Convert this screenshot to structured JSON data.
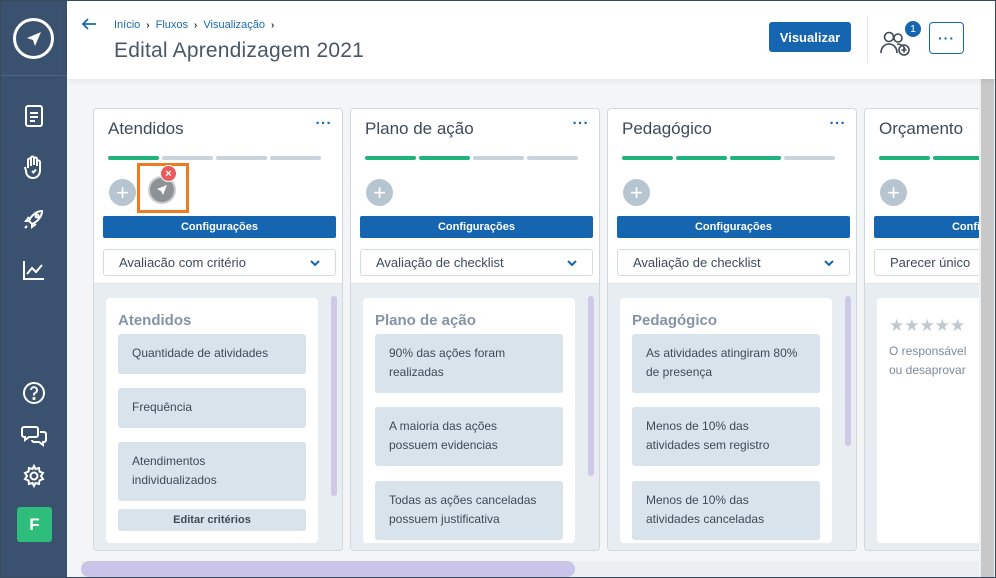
{
  "sidebar": {
    "logo_icon": "paper-plane-logo",
    "items": [
      {
        "icon": "document-icon"
      },
      {
        "icon": "hand-heart-icon"
      },
      {
        "icon": "rocket-icon"
      },
      {
        "icon": "chart-icon"
      }
    ],
    "bottom": [
      {
        "icon": "help-icon"
      },
      {
        "icon": "chat-icon"
      },
      {
        "icon": "gear-icon"
      }
    ],
    "avatar_letter": "F"
  },
  "header": {
    "breadcrumb": [
      "Início",
      "Fluxos",
      "Visualização"
    ],
    "title": "Edital Aprendizagem 2021",
    "visualizar_label": "Visualizar",
    "users_badge": "1",
    "more_label": "···"
  },
  "columns": [
    {
      "title": "Atendidos",
      "menu": "···",
      "progress_done": 1,
      "progress_total": 4,
      "config_label": "Configurações",
      "select_value": "Avaliacão com critério",
      "card_title": "Atendidos",
      "criteria": [
        "Quantidade de atividades",
        "Frequência",
        "Atendimentos individualizados"
      ],
      "edit_label": "Editar critérios"
    },
    {
      "title": "Plano de ação",
      "menu": "···",
      "progress_done": 2,
      "progress_total": 4,
      "config_label": "Configurações",
      "select_value": "Avaliação de checklist",
      "card_title": "Plano de ação",
      "criteria": [
        "90% das ações foram realizadas",
        "A maioria das ações possuem evidencias",
        "Todas as ações canceladas possuem justificativa"
      ]
    },
    {
      "title": "Pedagógico",
      "menu": "···",
      "progress_done": 3,
      "progress_total": 4,
      "config_label": "Configurações",
      "select_value": "Avaliação de checklist",
      "card_title": "Pedagógico",
      "criteria": [
        "As atividades atingiram 80% de presença",
        "Menos de 10% das atividades sem registro",
        "Menos de 10% das atividades canceladas"
      ]
    },
    {
      "title": "Orçamento",
      "progress_done": 2,
      "progress_total": 4,
      "config_label": "Configurações",
      "select_value": "Parecer único",
      "stars": "★★★★★",
      "partial_lines": [
        "O responsável",
        "ou desaprovar"
      ]
    }
  ],
  "colors": {
    "sidebar_bg": "#3a5170",
    "primary": "#1565b0",
    "progress_done": "#1cb47c",
    "highlight": "#f07b1f",
    "close_badge": "#e95a5a"
  }
}
